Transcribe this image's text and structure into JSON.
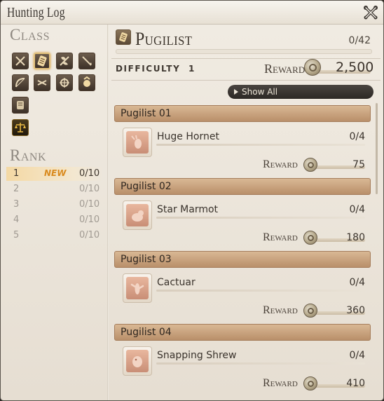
{
  "window": {
    "title": "Hunting Log",
    "close_icon": "close-tools-icon"
  },
  "sidebar": {
    "class_heading": "Class",
    "class_icons": [
      {
        "name": "gladiator-icon",
        "selected": false
      },
      {
        "name": "pugilist-icon",
        "selected": true
      },
      {
        "name": "marauder-icon",
        "selected": false
      },
      {
        "name": "lancer-icon",
        "selected": false
      },
      {
        "name": "archer-icon",
        "selected": false
      },
      {
        "name": "rogue-icon",
        "selected": false
      },
      {
        "name": "conjurer-icon",
        "selected": false
      },
      {
        "name": "thaumaturge-icon",
        "selected": false
      },
      {
        "name": "arcanist-icon",
        "selected": false
      },
      {
        "name": "grand-company-icon",
        "selected": false
      }
    ],
    "rank_heading": "Rank",
    "ranks": [
      {
        "rank": "1",
        "badge": "NEW",
        "progress": "0/10",
        "selected": true
      },
      {
        "rank": "2",
        "badge": "",
        "progress": "0/10",
        "selected": false
      },
      {
        "rank": "3",
        "badge": "",
        "progress": "0/10",
        "selected": false
      },
      {
        "rank": "4",
        "badge": "",
        "progress": "0/10",
        "selected": false
      },
      {
        "rank": "5",
        "badge": "",
        "progress": "0/10",
        "selected": false
      }
    ]
  },
  "header": {
    "class_name": "Pugilist",
    "progress": "0/42",
    "difficulty_label": "DIFFICULTY",
    "difficulty_value": "1",
    "reward_label": "Reward",
    "reward_value": "2,500"
  },
  "filter": {
    "label": "Show All"
  },
  "entries": [
    {
      "group": "Pugilist 01",
      "monster": "Huge Hornet",
      "count": "0/4",
      "reward_label": "Reward",
      "reward": "75",
      "icon": "hornet-icon"
    },
    {
      "group": "Pugilist 02",
      "monster": "Star Marmot",
      "count": "0/4",
      "reward_label": "Reward",
      "reward": "180",
      "icon": "marmot-icon"
    },
    {
      "group": "Pugilist 03",
      "monster": "Cactuar",
      "count": "0/4",
      "reward_label": "Reward",
      "reward": "360",
      "icon": "cactuar-icon"
    },
    {
      "group": "Pugilist 04",
      "monster": "Snapping Shrew",
      "count": "0/4",
      "reward_label": "Reward",
      "reward": "410",
      "icon": "shrew-icon"
    }
  ],
  "colors": {
    "accent_new": "#d98a1e",
    "group_bar": "#c9a27c",
    "panel_bg": "#efe9df"
  }
}
